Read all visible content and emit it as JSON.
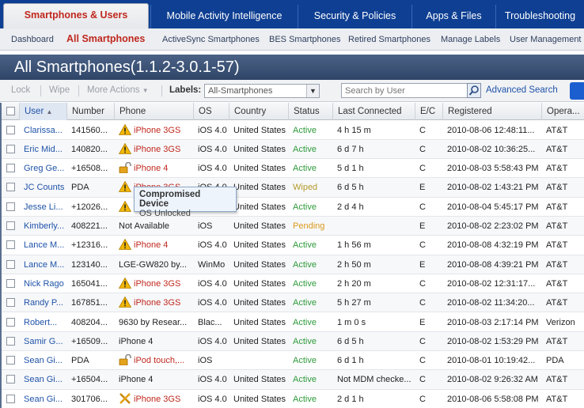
{
  "nav": {
    "tabs": [
      {
        "label": "Smartphones & Users",
        "active": true
      },
      {
        "label": "Mobile Activity Intelligence"
      },
      {
        "label": "Security & Policies"
      },
      {
        "label": "Apps & Files"
      },
      {
        "label": "Troubleshooting"
      }
    ],
    "subtabs": [
      {
        "label": "Dashboard"
      },
      {
        "label": "All Smartphones",
        "active": true
      },
      {
        "label": "ActiveSync Smartphones"
      },
      {
        "label": "BES Smartphones"
      },
      {
        "label": "Retired Smartphones"
      },
      {
        "label": "Manage Labels"
      },
      {
        "label": "User Management"
      }
    ]
  },
  "page": {
    "title": "All Smartphones(1.1.2-3.0.1-57)"
  },
  "toolbar": {
    "lock": "Lock",
    "wipe": "Wipe",
    "more_actions": "More Actions",
    "labels_label": "Labels:",
    "labels_value": "All-Smartphones",
    "search_placeholder": "Search by User",
    "advanced_search": "Advanced Search"
  },
  "table": {
    "columns": [
      "User",
      "Number",
      "Phone",
      "OS",
      "Country",
      "Status",
      "Last Connected",
      "E/C",
      "Registered",
      "Opera..."
    ],
    "rows": [
      {
        "user": "Clarissa...",
        "number": "141560...",
        "icon": "warning",
        "phone": "iPhone 3GS",
        "os": "iOS 4.0",
        "country": "United States",
        "status": "Active",
        "last": "4 h 15 m",
        "ec": "C",
        "registered": "2010-08-06 12:48:11...",
        "operator": "AT&T"
      },
      {
        "user": "Eric Mid...",
        "number": "140820...",
        "icon": "warning",
        "phone": "iPhone 3GS",
        "os": "iOS 4.0",
        "country": "United States",
        "status": "Active",
        "last": "6 d 7 h",
        "ec": "C",
        "registered": "2010-08-02 10:36:25...",
        "operator": "AT&T"
      },
      {
        "user": "Greg Ge...",
        "number": "+16508...",
        "icon": "lock",
        "phone": "iPhone 4",
        "os": "iOS 4.0",
        "country": "United States",
        "status": "Active",
        "last": "5 d 1 h",
        "ec": "C",
        "registered": "2010-08-03 5:58:43 PM",
        "operator": "AT&T"
      },
      {
        "user": "JC Counts",
        "number": "PDA",
        "icon": "warning",
        "phone": "iPhone 3GS",
        "os": "iOS 4.0",
        "country": "United States",
        "status": "Wiped",
        "last": "6 d 5 h",
        "ec": "E",
        "registered": "2010-08-02 1:43:21 PM",
        "operator": "AT&T"
      },
      {
        "user": "Jesse Li...",
        "number": "+12026...",
        "icon": "warning",
        "phone": "iPhone 4",
        "os": "iOS 4.0",
        "country": "United States",
        "status": "Active",
        "last": "2 d 4 h",
        "ec": "C",
        "registered": "2010-08-04 5:45:17 PM",
        "operator": "AT&T"
      },
      {
        "user": "Kimberly...",
        "number": "408221...",
        "icon": "",
        "phone": "Not Available",
        "os": "iOS",
        "country": "United States",
        "status": "Pending",
        "last": "",
        "ec": "E",
        "registered": "2010-08-02 2:23:02 PM",
        "operator": "AT&T"
      },
      {
        "user": "Lance M...",
        "number": "+12316...",
        "icon": "warning",
        "phone": "iPhone 4",
        "os": "iOS 4.0",
        "country": "United States",
        "status": "Active",
        "last": "1 h 56 m",
        "ec": "C",
        "registered": "2010-08-08 4:32:19 PM",
        "operator": "AT&T"
      },
      {
        "user": "Lance M...",
        "number": "123140...",
        "icon": "",
        "phone": "LGE-GW820 by...",
        "os": "WinMo",
        "country": "United States",
        "status": "Active",
        "last": "2 h 50 m",
        "ec": "E",
        "registered": "2010-08-08 4:39:21 PM",
        "operator": "AT&T"
      },
      {
        "user": "Nick Rago",
        "number": "165041...",
        "icon": "warning",
        "phone": "iPhone 3GS",
        "os": "iOS 4.0",
        "country": "United States",
        "status": "Active",
        "last": "2 h 20 m",
        "ec": "C",
        "registered": "2010-08-02 12:31:17...",
        "operator": "AT&T"
      },
      {
        "user": "Randy P...",
        "number": "167851...",
        "icon": "warning",
        "phone": "iPhone 3GS",
        "os": "iOS 4.0",
        "country": "United States",
        "status": "Active",
        "last": "5 h 27 m",
        "ec": "C",
        "registered": "2010-08-02 11:34:20...",
        "operator": "AT&T"
      },
      {
        "user": "Robert...",
        "number": "408204...",
        "icon": "",
        "phone": "9630 by Resear...",
        "os": "Blac...",
        "country": "United States",
        "status": "Active",
        "last": "1 m 0 s",
        "ec": "E",
        "registered": "2010-08-03 2:17:14 PM",
        "operator": "Verizon"
      },
      {
        "user": "Samir G...",
        "number": "+16509...",
        "icon": "",
        "phone": "iPhone 4",
        "os": "iOS 4.0",
        "country": "United States",
        "status": "Active",
        "last": "6 d 5 h",
        "ec": "C",
        "registered": "2010-08-02 1:53:29 PM",
        "operator": "AT&T"
      },
      {
        "user": "Sean Gi...",
        "number": "PDA",
        "icon": "lock",
        "phone": "iPod touch,...",
        "os": "iOS",
        "country": "",
        "status": "Active",
        "last": "6 d 1 h",
        "ec": "C",
        "registered": "2010-08-01 10:19:42...",
        "operator": "PDA"
      },
      {
        "user": "Sean Gi...",
        "number": "+16504...",
        "icon": "",
        "phone": "iPhone 4",
        "os": "iOS 4.0",
        "country": "United States",
        "status": "Active",
        "last": "Not MDM checke...",
        "ec": "C",
        "registered": "2010-08-02 9:26:32 AM",
        "operator": "AT&T"
      },
      {
        "user": "Sean Gi...",
        "number": "301706...",
        "icon": "cross",
        "phone": "iPhone 3GS",
        "os": "iOS 4.0",
        "country": "United States",
        "status": "Active",
        "last": "2 d 1 h",
        "ec": "C",
        "registered": "2010-08-06 5:58:08 PM",
        "operator": "AT&T"
      }
    ]
  },
  "tooltip": {
    "title": "Compromised Device",
    "detail": "OS Unlocked"
  },
  "colors": {
    "nav": "#0e3f93",
    "accent_red": "#c0281e",
    "active_green": "#2e9a3a",
    "link_blue": "#1f53a8"
  }
}
